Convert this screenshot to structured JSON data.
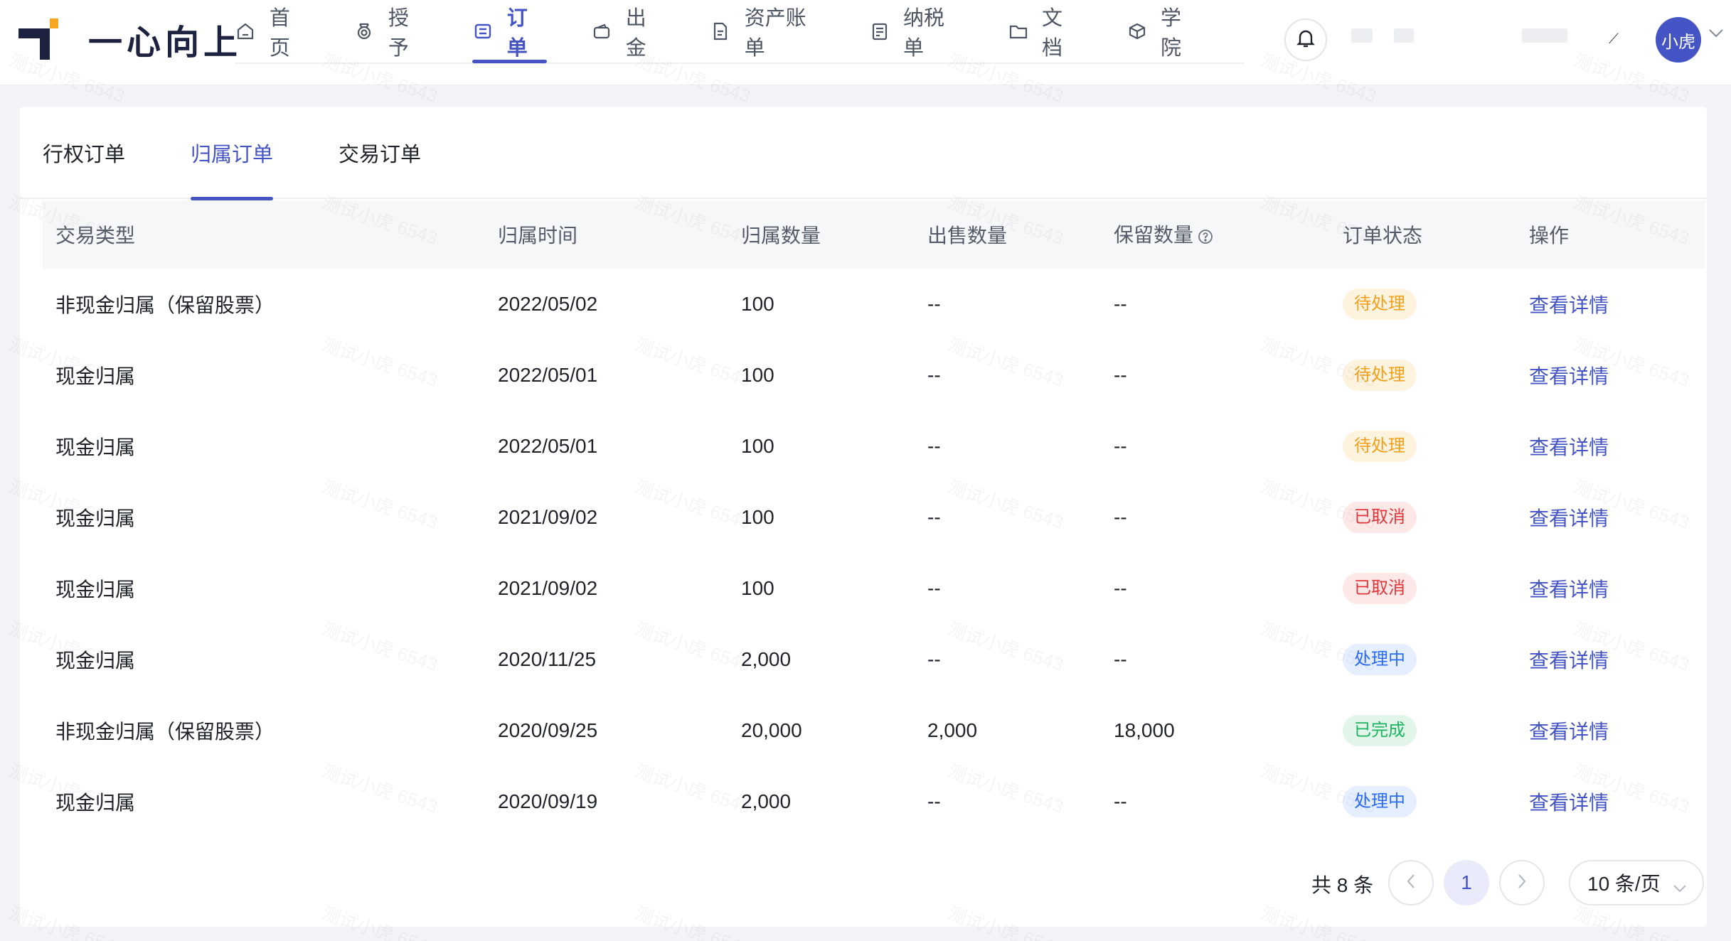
{
  "brand": {
    "name": "一心向上"
  },
  "nav": [
    {
      "label": "首页",
      "icon": "home-icon"
    },
    {
      "label": "授予",
      "icon": "medal-icon"
    },
    {
      "label": "订单",
      "icon": "order-icon",
      "active": true
    },
    {
      "label": "出金",
      "icon": "wallet-icon"
    },
    {
      "label": "资产账单",
      "icon": "bill-icon"
    },
    {
      "label": "纳税单",
      "icon": "tax-icon"
    },
    {
      "label": "文档",
      "icon": "folder-icon"
    },
    {
      "label": "学院",
      "icon": "academy-icon"
    }
  ],
  "user": {
    "avatar_text": "小虎"
  },
  "tabs": [
    {
      "label": "行权订单"
    },
    {
      "label": "归属订单",
      "active": true
    },
    {
      "label": "交易订单"
    }
  ],
  "table": {
    "columns": [
      "交易类型",
      "归属时间",
      "归属数量",
      "出售数量",
      "保留数量",
      "订单状态",
      "操作"
    ],
    "rows": [
      {
        "type": "非现金归属（保留股票）",
        "date": "2022/05/02",
        "vest": "100",
        "sold": "--",
        "kept": "--",
        "status": "待处理",
        "status_kind": "pending",
        "action": "查看详情"
      },
      {
        "type": "现金归属",
        "date": "2022/05/01",
        "vest": "100",
        "sold": "--",
        "kept": "--",
        "status": "待处理",
        "status_kind": "pending",
        "action": "查看详情"
      },
      {
        "type": "现金归属",
        "date": "2022/05/01",
        "vest": "100",
        "sold": "--",
        "kept": "--",
        "status": "待处理",
        "status_kind": "pending",
        "action": "查看详情"
      },
      {
        "type": "现金归属",
        "date": "2021/09/02",
        "vest": "100",
        "sold": "--",
        "kept": "--",
        "status": "已取消",
        "status_kind": "cancel",
        "action": "查看详情"
      },
      {
        "type": "现金归属",
        "date": "2021/09/02",
        "vest": "100",
        "sold": "--",
        "kept": "--",
        "status": "已取消",
        "status_kind": "cancel",
        "action": "查看详情"
      },
      {
        "type": "现金归属",
        "date": "2020/11/25",
        "vest": "2,000",
        "sold": "--",
        "kept": "--",
        "status": "处理中",
        "status_kind": "process",
        "action": "查看详情"
      },
      {
        "type": "非现金归属（保留股票）",
        "date": "2020/09/25",
        "vest": "20,000",
        "sold": "2,000",
        "kept": "18,000",
        "status": "已完成",
        "status_kind": "done",
        "action": "查看详情"
      },
      {
        "type": "现金归属",
        "date": "2020/09/19",
        "vest": "2,000",
        "sold": "--",
        "kept": "--",
        "status": "处理中",
        "status_kind": "process",
        "action": "查看详情"
      }
    ]
  },
  "pagination": {
    "total_text": "共 8 条",
    "current_page": "1",
    "page_size": "10 条/页"
  },
  "watermark": "测试小虎 6543",
  "colors": {
    "accent": "#4554c4",
    "pending": "#f0a11c",
    "cancel": "#e0373b",
    "process": "#2a6cf5",
    "done": "#1fb463"
  }
}
